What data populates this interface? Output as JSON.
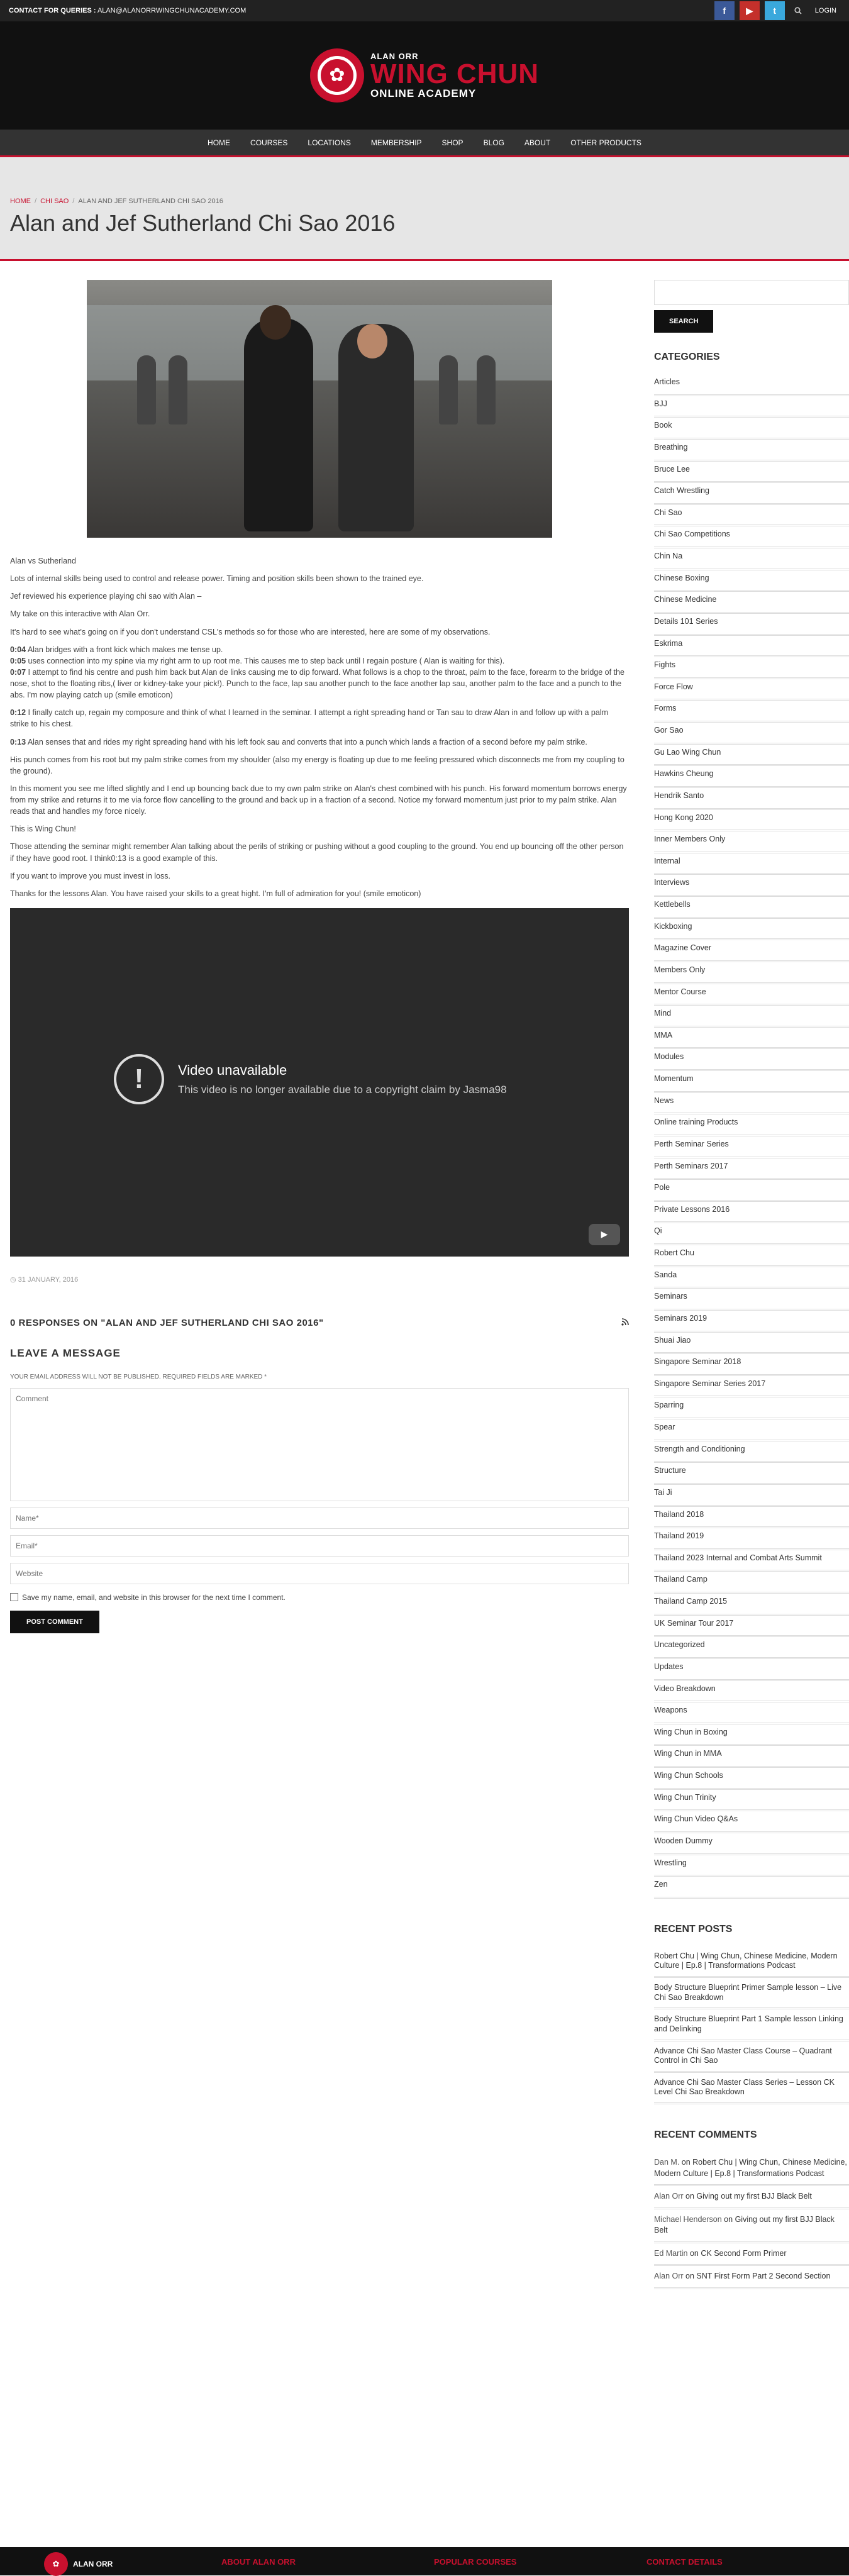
{
  "topbar": {
    "contact_label": "CONTACT FOR QUERIES :",
    "contact_email": "ALAN@ALANORRWINGCHUNACADEMY.COM",
    "facebook": "f",
    "youtube": "▶",
    "twitter": "t",
    "login": "LOGIN"
  },
  "logo": {
    "line1": "ALAN ORR",
    "line2": "WING CHUN",
    "line3": "ONLINE ACADEMY"
  },
  "nav": [
    "HOME",
    "COURSES",
    "LOCATIONS",
    "MEMBERSHIP",
    "SHOP",
    "BLOG",
    "ABOUT",
    "OTHER PRODUCTS"
  ],
  "breadcrumb": {
    "home": "HOME",
    "section": "CHI SAO",
    "current": "ALAN AND JEF SUTHERLAND CHI SAO 2016"
  },
  "page_title": "Alan and Jef Sutherland Chi Sao 2016",
  "post": {
    "p1": "Alan vs Sutherland",
    "p2": "Lots of internal skills being used to control and release power. Timing and position skills been shown to the trained eye.",
    "p3": "Jef reviewed his experience playing chi sao with Alan –",
    "p4": "My take on this interactive with Alan Orr.",
    "p5": "It's hard to see what's going on if you don't understand CSL's methods so for those who are interested, here are some of my observations.",
    "t1": "0:04",
    "p6a": " Alan bridges with a front kick which makes me tense up.",
    "t2": "0:05",
    "p6b": " uses connection into my spine via my right arm to up root me. This causes me to step back until I regain posture ( Alan is waiting for this).",
    "t3": "0:07",
    "p6c": " I attempt to find his centre and push him back but Alan de links causing me to dip forward. What follows is a chop to the throat, palm to the face, forearm to the bridge of the nose, shot to the floating ribs,( liver or kidney-take your pick!). Punch to the face, lap sau another punch to the face another lap sau, another palm to the face and a punch to the abs. I'm now playing catch up (smile emoticon)",
    "t4": "0:12",
    "p7": " I finally catch up, regain my composure and think of what I learned in the seminar. I attempt a right spreading hand or Tan sau to draw Alan in and follow up with a palm strike to his chest.",
    "t5": "0:13",
    "p8": " Alan senses that and rides my right spreading hand with his left fook sau and converts that into a punch which lands a fraction of a second before my palm strike.",
    "p9": "His punch comes from his root but my palm strike comes from my shoulder (also my energy is floating up due to me feeling pressured which disconnects me from my coupling to the ground).",
    "p10": "In this moment you see me lifted slightly and I end up bouncing back due to my own palm strike on Alan's chest combined with his punch. His forward momentum borrows energy from my strike and returns it to me via force flow cancelling to the ground and back up in a fraction of a second. Notice my forward momentum just prior to my palm strike. Alan reads that and handles my force nicely.",
    "p11": "This is Wing Chun!",
    "p12": "Those attending the seminar might remember Alan talking about the perils of striking or pushing without a good coupling to the ground. You end up bouncing off the other person if they have good root. I think0:13 is a good example of this.",
    "p13": "If you want to improve you must invest in loss.",
    "p14": "Thanks for the lessons Alan. You have raised your skills to a great hight. I'm full of admiration for you! (smile emoticon)"
  },
  "video": {
    "title": "Video unavailable",
    "message": "This video is no longer available due to a copyright claim by Jasma98"
  },
  "post_date": "31 JANUARY, 2016",
  "responses_title": "0 RESPONSES ON \"ALAN AND JEF SUTHERLAND CHI SAO 2016\"",
  "comment_form": {
    "title": "LEAVE A MESSAGE",
    "notes": "YOUR EMAIL ADDRESS WILL NOT BE PUBLISHED. REQUIRED FIELDS ARE MARKED *",
    "comment_placeholder": "Comment",
    "name_placeholder": "Name*",
    "email_placeholder": "Email*",
    "website_placeholder": "Website",
    "save_label": "Save my name, email, and website in this browser for the next time I comment.",
    "submit_label": "POST COMMENT"
  },
  "sidebar": {
    "search_button": "SEARCH",
    "categories_title": "CATEGORIES",
    "categories": [
      "Articles",
      "BJJ",
      "Book",
      "Breathing",
      "Bruce Lee",
      "Catch Wrestling",
      "Chi Sao",
      "Chi Sao Competitions",
      "Chin Na",
      "Chinese Boxing",
      "Chinese Medicine",
      "Details 101 Series",
      "Eskrima",
      "Fights",
      "Force Flow",
      "Forms",
      "Gor Sao",
      "Gu Lao Wing Chun",
      "Hawkins Cheung",
      "Hendrik Santo",
      "Hong Kong 2020",
      "Inner Members Only",
      "Internal",
      "Interviews",
      "Kettlebells",
      "Kickboxing",
      "Magazine Cover",
      "Members Only",
      "Mentor Course",
      "Mind",
      "MMA",
      "Modules",
      "Momentum",
      "News",
      "Online training Products",
      "Perth Seminar Series",
      "Perth Seminars 2017",
      "Pole",
      "Private Lessons 2016",
      "Qi",
      "Robert Chu",
      "Sanda",
      "Seminars",
      "Seminars 2019",
      "Shuai Jiao",
      "Singapore Seminar 2018",
      "Singapore Seminar Series 2017",
      "Sparring",
      "Spear",
      "Strength and Conditioning",
      "Structure",
      "Tai Ji",
      "Thailand 2018",
      "Thailand 2019",
      "Thailand 2023 Internal and Combat Arts Summit",
      "Thailand Camp",
      "Thailand Camp 2015",
      "UK Seminar Tour 2017",
      "Uncategorized",
      "Updates",
      "Video Breakdown",
      "Weapons",
      "Wing Chun in Boxing",
      "Wing Chun in MMA",
      "Wing Chun Schools",
      "Wing Chun Trinity",
      "Wing Chun Video Q&As",
      "Wooden Dummy",
      "Wrestling",
      "Zen"
    ],
    "recent_posts_title": "RECENT POSTS",
    "recent_posts": [
      "Robert Chu | Wing Chun, Chinese Medicine, Modern Culture | Ep.8 | Transformations Podcast",
      "Body Structure Blueprint Primer Sample lesson – Live Chi Sao Breakdown",
      "Body Structure Blueprint Part 1 Sample lesson Linking and Delinking",
      "Advance Chi Sao Master Class Course – Quadrant Control in Chi Sao",
      "Advance Chi Sao Master Class Series – Lesson CK Level Chi Sao Breakdown"
    ],
    "recent_comments_title": "RECENT COMMENTS",
    "recent_comments": [
      {
        "author": "Dan M.",
        "on": " on ",
        "post": "Robert Chu | Wing Chun, Chinese Medicine, Modern Culture | Ep.8 | Transformations Podcast"
      },
      {
        "author": "Alan Orr",
        "on": " on ",
        "post": "Giving out my first BJJ Black Belt"
      },
      {
        "author": "Michael Henderson",
        "on": " on ",
        "post": "Giving out my first BJJ Black Belt"
      },
      {
        "author": "Ed Martin",
        "on": " on ",
        "post": "CK Second Form Primer"
      },
      {
        "author": "Alan Orr",
        "on": " on ",
        "post": "SNT First Form Part 2 Second Section"
      }
    ]
  },
  "footer": {
    "name": "ALAN ORR",
    "about": "ABOUT ALAN ORR",
    "popular": "POPULAR COURSES",
    "contact": "CONTACT DETAILS"
  }
}
